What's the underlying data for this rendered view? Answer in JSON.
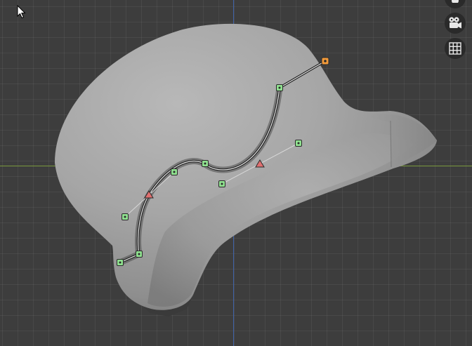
{
  "viewport": {
    "background": "#3d3d3d",
    "axis_x_color": "#7a9a3c",
    "axis_y_color": "#3f62a8",
    "mesh_color": "#a9a9a9"
  },
  "curve": {
    "points": [
      {
        "kind": "end",
        "color": "#f29a3a",
        "selected": true
      },
      {
        "kind": "handle",
        "color": "#8fe08f"
      },
      {
        "kind": "handle",
        "color": "#8fe08f"
      },
      {
        "kind": "vector",
        "color": "#e07070"
      },
      {
        "kind": "handle",
        "color": "#8fe08f"
      },
      {
        "kind": "aligned",
        "color": "#8fe08f"
      },
      {
        "kind": "handle",
        "color": "#8fe08f"
      },
      {
        "kind": "vector",
        "color": "#e07070"
      },
      {
        "kind": "handle",
        "color": "#8fe08f"
      },
      {
        "kind": "aligned",
        "color": "#8fe08f"
      },
      {
        "kind": "handle",
        "color": "#8fe08f"
      }
    ]
  },
  "navigation": {
    "buttons": [
      {
        "id": "view",
        "icon": "view-icon"
      },
      {
        "id": "camera",
        "icon": "camera-icon"
      },
      {
        "id": "grid",
        "icon": "grid-icon"
      }
    ]
  },
  "cursor": {
    "icon": "mouse-pointer-icon"
  }
}
